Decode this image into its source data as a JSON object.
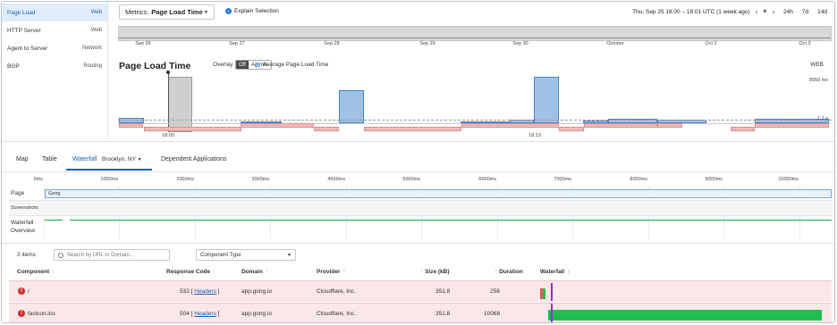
{
  "sidebar": {
    "items": [
      {
        "label": "Page Load",
        "type": "Web",
        "active": true
      },
      {
        "label": "HTTP Server",
        "type": "Web"
      },
      {
        "label": "Agent to Server",
        "type": "Network"
      },
      {
        "label": "BGP",
        "type": "Routing"
      }
    ]
  },
  "header": {
    "metrics_prefix": "Metrics:",
    "metrics_value": "Page Load Time",
    "explain_label": "Explain Selection",
    "time_range": "Thu, Sep 25 18:00 – 18:01 UTC (1 week ago)",
    "ranges": [
      "24h",
      "7d",
      "14d"
    ]
  },
  "overview": {
    "labels": [
      "Sep 26",
      "Sep 27",
      "Sep 28",
      "Sep 29",
      "Sep 30",
      "October",
      "Oct 2",
      "Oct 3"
    ]
  },
  "chart": {
    "title": "Page Load Time",
    "overlay_label": "Overlay",
    "overlay_off": "Off",
    "overlay_agents": "Agents",
    "legend_label": "Average Page Load Time",
    "scope": "WEB",
    "y_top_label": "8950 ms",
    "y_mid_label": "1.1 s",
    "x_labels": [
      "18:00",
      "18:13"
    ]
  },
  "chart_data": {
    "type": "bar",
    "title": "Page Load Time",
    "series": [
      {
        "name": "Average Page Load Time",
        "values": [
          1.1,
          0.4,
          3.8,
          8.9,
          1.0,
          4.6,
          1.0,
          0.7,
          8.9,
          1.0,
          1.1,
          1.0,
          0.4,
          0.9
        ]
      }
    ],
    "ylabel": "",
    "y_ticks": [
      "1.1 s",
      "8950 ms"
    ]
  },
  "tabs": {
    "map": "Map",
    "table": "Table",
    "waterfall": "Waterfall",
    "location": "Brooklyn, NY",
    "dependent": "Dependent Applications"
  },
  "waterfall": {
    "ruler": [
      "0ms",
      "1000ms",
      "2000ms",
      "3000ms",
      "4000ms",
      "5000ms",
      "6000ms",
      "7000ms",
      "8000ms",
      "9000ms",
      "10000ms"
    ],
    "page_label": "Page",
    "page_bar_text": "Gong",
    "screenshots_label": "Screenshots",
    "overview_label_1": "Waterfall",
    "overview_label_2": "Overview"
  },
  "toolbar": {
    "items_count": "2 items",
    "search_placeholder": "Search by URL or Domain...",
    "component_type": "Component Type"
  },
  "table": {
    "headers": {
      "component": "Component",
      "response_code": "Response Code",
      "domain": "Domain",
      "provider": "Provider",
      "size": "Size (kB)",
      "duration": "Duration",
      "waterfall": "Waterfall"
    },
    "rows": [
      {
        "component": "/",
        "code": "532",
        "headers": "Headers",
        "domain": "app.gong.io",
        "provider": "Cloudflare, Inc.",
        "size": "351.8",
        "duration": "258"
      },
      {
        "component": "favicon.ico",
        "code": "504",
        "headers": "Headers",
        "domain": "app.gong.io",
        "provider": "Cloudflare, Inc.",
        "size": "351.8",
        "duration": "10068"
      }
    ]
  }
}
